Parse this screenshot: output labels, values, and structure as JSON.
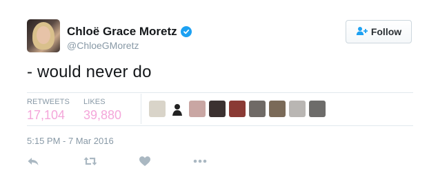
{
  "user": {
    "name": "Chloë Grace Moretz",
    "handle": "@ChloeGMoretz",
    "verified": true
  },
  "follow": {
    "label": "Follow",
    "icon": "add-user-icon"
  },
  "tweet": {
    "text": "- would never do",
    "timestamp": "5:15 PM - 7 Mar 2016"
  },
  "stats": {
    "retweets_label": "RETWEETS",
    "retweets_value": "17,104",
    "likes_label": "LIKES",
    "likes_value": "39,880"
  },
  "likers": [
    {
      "color": "#d9d4c9"
    },
    {
      "color": "#ffffff"
    },
    {
      "color": "#c9a6a3"
    },
    {
      "color": "#3b3130"
    },
    {
      "color": "#8a3a34"
    },
    {
      "color": "#6f6a66"
    },
    {
      "color": "#7a6a58"
    },
    {
      "color": "#b9b6b3"
    },
    {
      "color": "#6d6c6a"
    }
  ],
  "actions": [
    "reply-icon",
    "retweet-icon",
    "like-icon",
    "more-icon"
  ],
  "colors": {
    "accent": "#1da1f2",
    "likes_pink": "#f4a6da",
    "muted": "#8899a6",
    "icon_gray": "#aab8c2"
  }
}
